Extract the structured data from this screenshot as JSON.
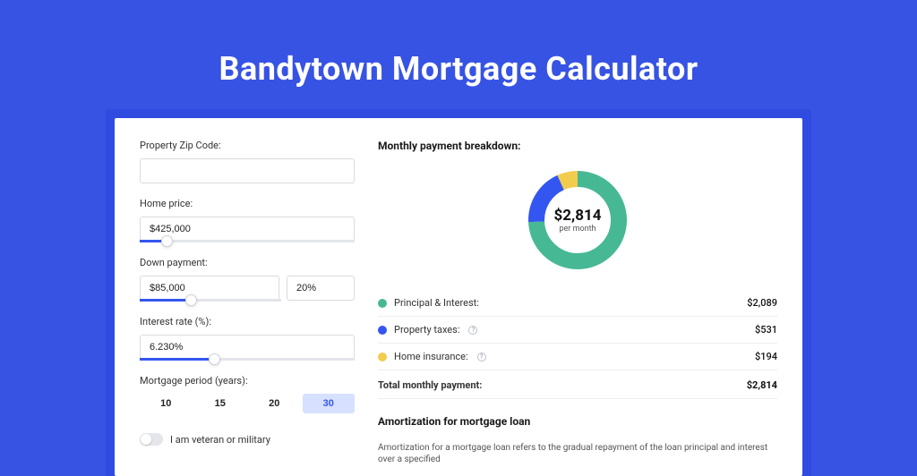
{
  "page_title": "Bandytown Mortgage Calculator",
  "form": {
    "zip_label": "Property Zip Code:",
    "zip_value": "",
    "home_label": "Home price:",
    "home_value": "$425,000",
    "down_label": "Down payment:",
    "down_value": "$85,000",
    "down_pct": "20%",
    "rate_label": "Interest rate (%):",
    "rate_value": "6.230%",
    "period_label": "Mortgage period (years):",
    "period_options": [
      "10",
      "15",
      "20",
      "30"
    ],
    "period_selected": "30",
    "veteran_label": "I am veteran or military"
  },
  "breakdown": {
    "title": "Monthly payment breakdown:",
    "donut_amount": "$2,814",
    "donut_sub": "per month",
    "items": [
      {
        "label": "Principal & Interest:",
        "value": "$2,089",
        "color": "#47b894",
        "info": false
      },
      {
        "label": "Property taxes:",
        "value": "$531",
        "color": "#3456f0",
        "info": true
      },
      {
        "label": "Home insurance:",
        "value": "$194",
        "color": "#f2cc4d",
        "info": true
      }
    ],
    "total_label": "Total monthly payment:",
    "total_value": "$2,814"
  },
  "amort": {
    "title": "Amortization for mortgage loan",
    "desc": "Amortization for a mortgage loan refers to the gradual repayment of the loan principal and interest over a specified"
  },
  "chart_data": {
    "type": "pie",
    "title": "Monthly payment breakdown",
    "categories": [
      "Principal & Interest",
      "Property taxes",
      "Home insurance"
    ],
    "values": [
      2089,
      531,
      194
    ],
    "colors": [
      "#47b894",
      "#3456f0",
      "#f2cc4d"
    ],
    "total": 2814,
    "center_label": "$2,814 per month"
  }
}
